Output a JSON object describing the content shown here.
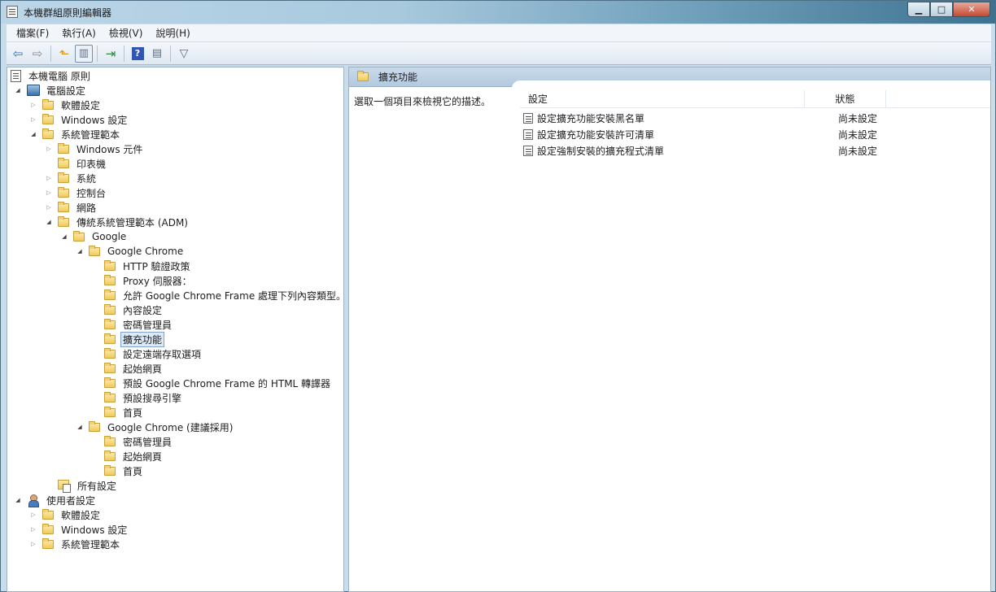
{
  "window": {
    "title": "本機群組原則編輯器",
    "controls": {
      "minimize": "▁",
      "maximize": "□",
      "close": "✕"
    }
  },
  "menu": [
    "檔案(F)",
    "執行(A)",
    "檢視(V)",
    "說明(H)"
  ],
  "toolbar": {
    "buttons": [
      {
        "name": "back-icon"
      },
      {
        "name": "forward-icon"
      },
      {
        "name": "up-icon"
      },
      {
        "name": "show-hide-tree-icon"
      },
      {
        "name": "export-list-icon"
      },
      {
        "name": "help-icon"
      },
      {
        "name": "view-icon"
      },
      {
        "name": "filter-icon"
      }
    ]
  },
  "tree": {
    "root": "本機電腦 原則",
    "computer": "電腦設定",
    "software": "軟體設定",
    "windows": "Windows 設定",
    "admin": "系統管理範本",
    "win_components": "Windows 元件",
    "printers": "印表機",
    "system": "系統",
    "control_panel": "控制台",
    "network": "網路",
    "classic_adm": "傳統系統管理範本 (ADM)",
    "google": "Google",
    "chrome": "Google Chrome",
    "chrome_items": [
      "HTTP 驗證政策",
      "Proxy 伺服器：",
      "允許 Google Chrome Frame 處理下列內容類型。",
      "內容設定",
      "密碼管理員",
      "擴充功能",
      "設定遠端存取選項",
      "起始網頁",
      "預設 Google Chrome Frame 的 HTML 轉譯器",
      "預設搜尋引擎",
      "首頁"
    ],
    "chrome_recommended": "Google Chrome (建議採用)",
    "recommended_items": [
      "密碼管理員",
      "起始網頁",
      "首頁"
    ],
    "all_settings": "所有設定",
    "user": "使用者設定",
    "user_software": "軟體設定",
    "user_windows": "Windows 設定",
    "user_admin": "系統管理範本"
  },
  "right_pane": {
    "title": "擴充功能",
    "description": "選取一個項目來檢視它的描述。",
    "columns": {
      "setting": "設定",
      "state": "狀態"
    },
    "rows": [
      {
        "name": "設定擴充功能安裝黑名單",
        "state": "尚未設定"
      },
      {
        "name": "設定擴充功能安裝許可清單",
        "state": "尚未設定"
      },
      {
        "name": "設定強制安裝的擴充程式清單",
        "state": "尚未設定"
      }
    ]
  }
}
